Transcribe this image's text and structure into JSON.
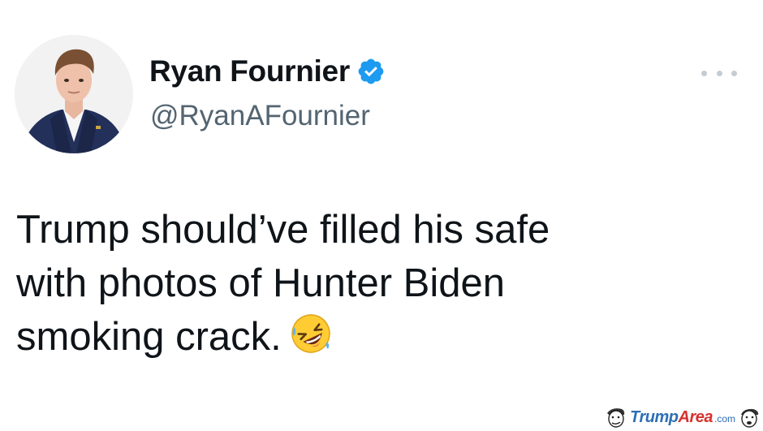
{
  "tweet": {
    "author": {
      "display_name": "Ryan Fournier",
      "handle": "@RyanAFournier",
      "verified": true,
      "avatar_icon": "profile-photo"
    },
    "more_icon": "more-horizontal-icon",
    "text_lines": [
      "Trump should’ve filled his safe",
      "with photos of Hunter Biden",
      "smoking crack."
    ],
    "emoji": "rolling-on-the-floor-laughing-emoji"
  },
  "watermark": {
    "name_part1": "Trump",
    "name_part2": "Area",
    "suffix": ".com"
  },
  "colors": {
    "text": "#0f1419",
    "handle": "#536471",
    "verified": "#1d9bf0",
    "watermark_blue": "#2c6fb5",
    "watermark_red": "#d6322f"
  }
}
